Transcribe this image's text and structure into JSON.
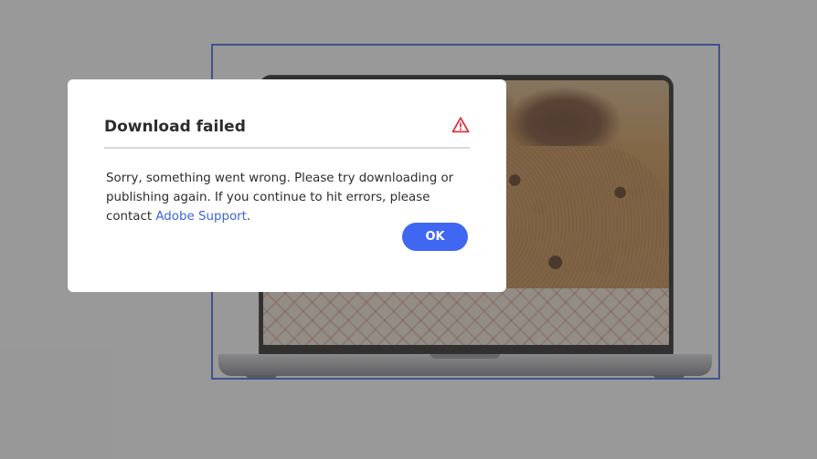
{
  "dialog": {
    "title": "Download failed",
    "icon": "alert-triangle-icon",
    "message_before_link": "Sorry, something went wrong. Please try downloading or publishing again. If you continue to hit errors, please contact ",
    "link_text": "Adobe Support",
    "message_after_link": ".",
    "ok_label": "OK"
  },
  "colors": {
    "accent": "#4067f2",
    "link": "#3d63dd",
    "alert": "#d7373f",
    "selection": "#3b5fd6"
  }
}
